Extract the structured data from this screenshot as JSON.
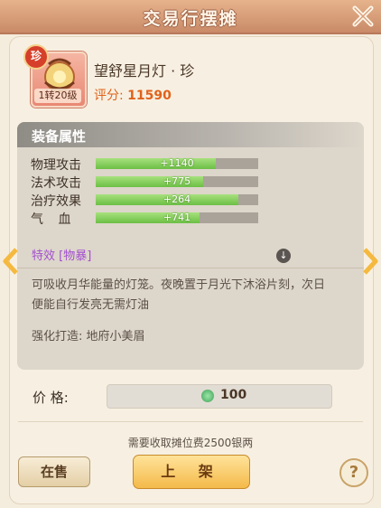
{
  "window": {
    "title": "交易行摆摊"
  },
  "item": {
    "rarity_badge": "珍",
    "level_badge": "1转20级",
    "name": "望舒星月灯 · 珍",
    "score_label": "评分:",
    "score_value": "11590"
  },
  "attributes": {
    "title": "装备属性",
    "stats": [
      {
        "label": "物理攻击",
        "value": "+1140",
        "fill": 0.74
      },
      {
        "label": "法术攻击",
        "value": "+775",
        "fill": 0.66
      },
      {
        "label": "治疗效果",
        "value": "+264",
        "fill": 0.88
      },
      {
        "label": "气 血",
        "value": "+741",
        "fill": 0.64
      }
    ],
    "special": "特效 [物暴]",
    "description": "可吸收月华能量的灯笼。夜晚置于月光下沐浴片刻，次日便能自行发亮无需灯油",
    "forge": "强化打造: 地府小美眉"
  },
  "price": {
    "label": "价 格:",
    "value": "100"
  },
  "fee_text": "需要收取摊位费2500银两",
  "buttons": {
    "on_sale": "在售",
    "list": "上 架",
    "help": "?"
  },
  "colors": {
    "score": "#e0621a",
    "special": "#a34fd0",
    "bar_fill": "#6cbf45",
    "list_button": "#f4b94a"
  }
}
